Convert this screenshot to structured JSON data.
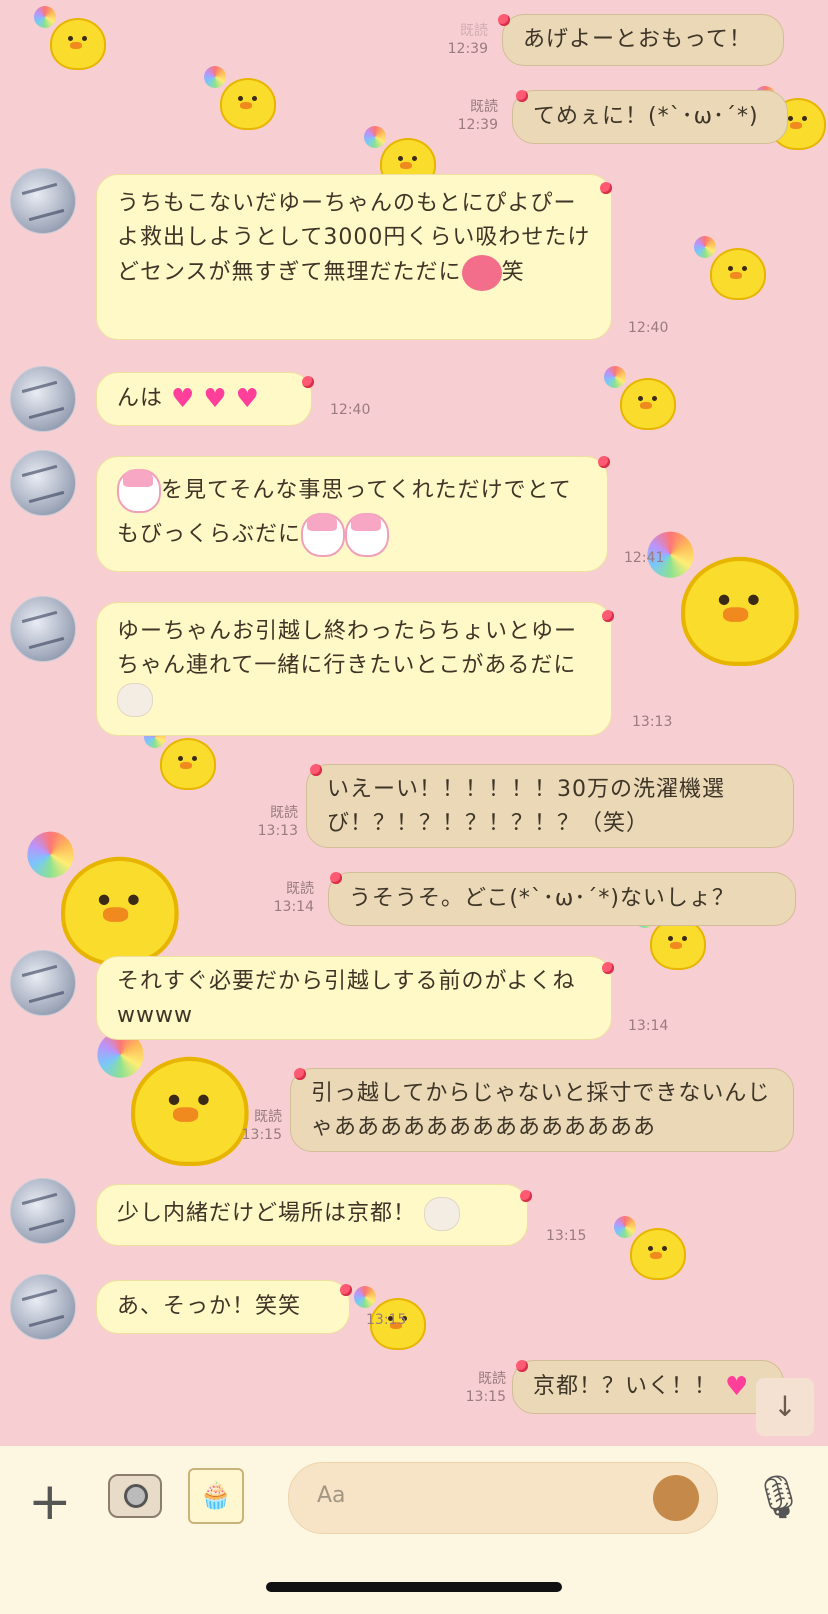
{
  "messages": [
    {
      "dir": "out",
      "text": "あげよーとおもって！",
      "read": "既読",
      "time": "12:39"
    },
    {
      "dir": "out",
      "text": "てめぇに！(*`･ω･´*)",
      "read": "既読",
      "time": "12:39"
    },
    {
      "dir": "in",
      "text": "うちもこないだゆーちゃんのもとにぴよぴーよ救出しようとして3000円くらい吸わせたけどセンスが無すぎて無理だただに",
      "suffix": "笑",
      "time": "12:40"
    },
    {
      "dir": "in",
      "text": "んは",
      "time": "12:40"
    },
    {
      "dir": "in",
      "text": "を見てそんな事思ってくれただけでとてもびっくらぶだに",
      "time": "12:41"
    },
    {
      "dir": "in",
      "text": "ゆーちゃんお引越し終わったらちょいとゆーちゃん連れて一緒に行きたいとこがあるだに",
      "time": "13:13"
    },
    {
      "dir": "out",
      "text": "いえーい！！！！！！30万の洗濯機選び！？！？！？！？！？（笑）",
      "read": "既読",
      "time": "13:13"
    },
    {
      "dir": "out",
      "text": "うそうそ。どこ(*`･ω･´*)ないしょ？",
      "read": "既読",
      "time": "13:14"
    },
    {
      "dir": "in",
      "text": "それすぐ必要だから引越しする前のがよくねwwww",
      "time": "13:14"
    },
    {
      "dir": "out",
      "text": "引っ越してからじゃないと採寸できないんじゃああああああああああああああ",
      "read": "既読",
      "time": "13:15"
    },
    {
      "dir": "in",
      "text": "少し内緒だけど場所は京都！",
      "time": "13:15"
    },
    {
      "dir": "in",
      "text": "あ、そっか！笑笑",
      "time": "13:15"
    },
    {
      "dir": "out",
      "text": "京都！？いく！！",
      "read": "既読",
      "time": "13:15"
    }
  ],
  "input": {
    "placeholder": "Aa"
  },
  "icons": {
    "plus": "plus-icon",
    "camera": "camera-icon",
    "sticker": "sticker-icon",
    "emoji": "emoji-bear-icon",
    "mic": "microphone-icon",
    "scroll": "arrow-down-icon"
  }
}
